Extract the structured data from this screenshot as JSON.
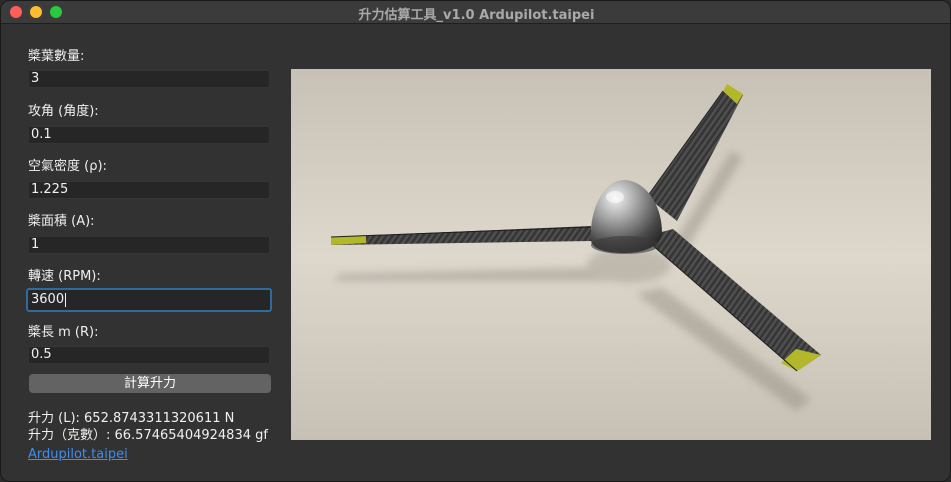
{
  "window": {
    "title": "升力估算工具_v1.0 Ardupilot.taipei"
  },
  "form": {
    "blade_count": {
      "label": "槳葉數量:",
      "value": "3"
    },
    "attack_angle": {
      "label": "攻角 (角度):",
      "value": "0.1"
    },
    "air_density": {
      "label": "空氣密度 (ρ):",
      "value": "1.225"
    },
    "blade_area": {
      "label": "槳面積 (A):",
      "value": "1"
    },
    "rpm": {
      "label": "轉速 (RPM):",
      "value": "3600"
    },
    "blade_length": {
      "label": "槳長 m (R):",
      "value": "0.5"
    }
  },
  "calculate_button": "計算升力",
  "results": {
    "lift_newton": "升力 (L): 652.8743311320611 N",
    "lift_grams": "升力（克數）: 66.57465404924834 gf"
  },
  "link_text": "Ardupilot.taipei",
  "image": {
    "subject": "three-blade carbon propeller"
  },
  "colors": {
    "window_bg": "#323232",
    "accent_focus": "#2f6aa1",
    "link": "#3d8ef0"
  }
}
